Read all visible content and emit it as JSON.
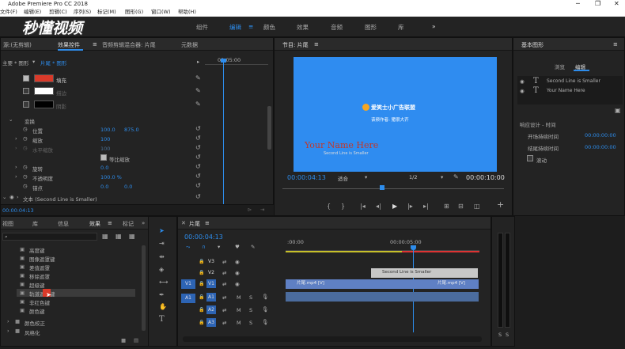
{
  "app": {
    "title": "Adobe Premiere Pro CC 2018",
    "logo_text": "秒懂视频"
  },
  "menu": [
    "文件(F)",
    "编辑(E)",
    "剪辑(C)",
    "序列(S)",
    "标记(M)",
    "图形(G)",
    "窗口(W)",
    "帮助(H)"
  ],
  "workspaces": {
    "items": [
      "组件",
      "编辑",
      "颜色",
      "效果",
      "音频",
      "图形",
      "库"
    ],
    "active": "编辑",
    "more": "»"
  },
  "source_panel": {
    "tabs": [
      "源:(无剪辑)",
      "效果控件",
      "音频剪辑混合器: 片尾",
      "元数据"
    ],
    "breadcrumb_master": "主要 * 图形",
    "breadcrumb_clip": "片尾 * 图形",
    "timecode_ruler": "00:05:00",
    "rows": [
      {
        "label": "填充"
      },
      {
        "label": "描边"
      },
      {
        "label": "阴影"
      }
    ],
    "transform_label": "变换",
    "position": {
      "label": "位置",
      "x": "100.0",
      "y": "875.0"
    },
    "scale": {
      "label": "缩放",
      "value": "100"
    },
    "scale_width": {
      "label": "水平缩放",
      "value": "100"
    },
    "uniform_scale": "等比缩放",
    "rotation": {
      "label": "旋转",
      "value": "0.0"
    },
    "opacity": {
      "label": "不透明度",
      "value": "100.0 %"
    },
    "anchor": {
      "label": "锚点",
      "x": "0.0",
      "y": "0.0"
    },
    "text_layer": "文本 (Second Line is Smaller)",
    "current_time": "00:00:04:13",
    "fill_color": "#d93a2a"
  },
  "program_panel": {
    "tab": "节目: 片尾",
    "timecode": "00:00:04:13",
    "fit": "适合",
    "resolution": "1/2",
    "duration": "00:00:10:00",
    "brand_line": "爱笑士小广告联盟",
    "author_line": "该频作者: 猪很大齐",
    "small_line": "Second Line is Smaller",
    "big_line": "Your Name Here",
    "bg_color": "#2f8cf0"
  },
  "essential_graphics": {
    "title": "基本图形",
    "tabs": [
      "浏览",
      "编辑"
    ],
    "active_tab": "编辑",
    "layers": [
      "Second Line is Smaller",
      "Your Name Here"
    ],
    "responsive_design": "响应设计 - 时间",
    "intro_label": "开场持续时间",
    "intro_value": "00:00:00:00",
    "outro_label": "结尾持续时间",
    "outro_value": "00:00:00:00",
    "roll": "滚动"
  },
  "effects_panel": {
    "tabs": [
      "视图",
      "库",
      "信息",
      "效果",
      "标记"
    ],
    "more": "»",
    "items": [
      "高度键",
      "图像遮罩键",
      "差值遮罩",
      "移除遮罩",
      "超级键",
      "轨道遮罩键",
      "非红色键",
      "颜色键"
    ],
    "folders": [
      "颜色校正",
      "风格化"
    ],
    "selected_index": 5
  },
  "timeline": {
    "tab": "片尾",
    "timecode": "00:00:04:13",
    "ruler": [
      ":00:00",
      "00:00:05:00"
    ],
    "video_tracks": [
      "V3",
      "V2",
      "V1"
    ],
    "audio_tracks": [
      "A1",
      "A2",
      "A3"
    ],
    "source_v": "V1",
    "source_a": "A1",
    "track_buttons": {
      "mute": "M",
      "solo": "S"
    },
    "graphic_clip": "Second Line is Smaller",
    "video_clip_1": "片尾.mp4 [V]",
    "video_clip_2": "片尾.mp4 [V]"
  },
  "meter_labels": [
    "S",
    "S"
  ]
}
